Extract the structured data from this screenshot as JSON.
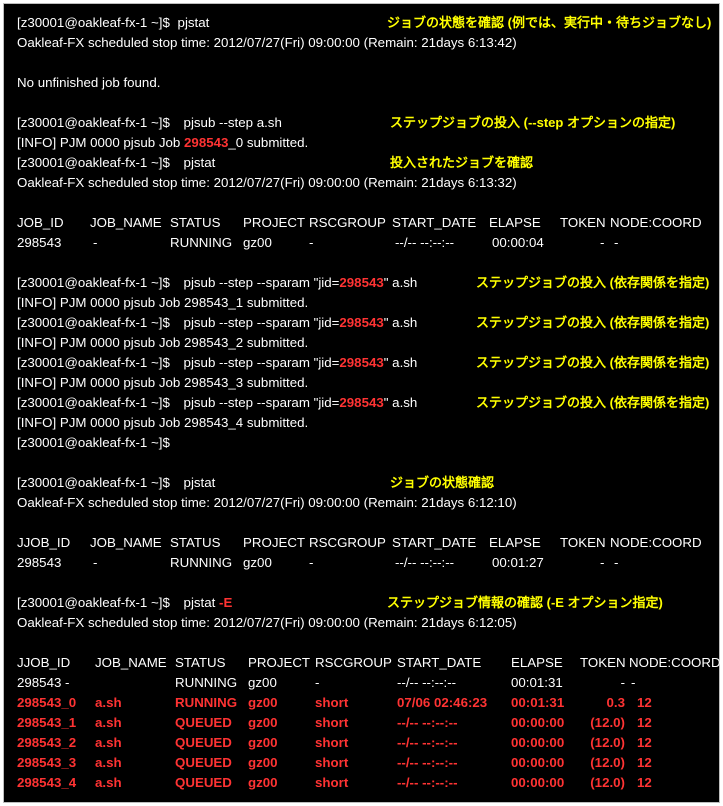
{
  "colors": {
    "background": "#000000",
    "text": "#ffffff",
    "note": "#ffff00",
    "highlight": "#ff3333"
  },
  "prompt": "[z30001@oakleaf-fx-1 ~]$",
  "stop_time_text": {
    "a": "Oakleaf-FX scheduled stop time: 2012/07/27(Fri) 09:00:00 (Remain: 21days 6:13:42)",
    "b": "Oakleaf-FX scheduled stop time: 2012/07/27(Fri) 09:00:00 (Remain: 21days 6:13:32)",
    "c": "Oakleaf-FX scheduled stop time: 2012/07/27(Fri) 09:00:00 (Remain: 21days 6:12:10)",
    "d": "Oakleaf-FX scheduled stop time: 2012/07/27(Fri) 09:00:00 (Remain: 21days 6:12:05)"
  },
  "block1": {
    "cmd": "pjstat",
    "note": "ジョブの状態を確認 (例では、実行中・待ちジョブなし)",
    "result": "No unfinished job found."
  },
  "block2": {
    "cmd": "pjsub --step a.sh",
    "note": "ステップジョブの投入 (--step オプションの指定)",
    "info_pre": "[INFO] PJM 0000 pjsub Job ",
    "job_id": "298543",
    "info_post": "_0 submitted.",
    "cmd2": "pjstat",
    "note2": "投入されたジョブを確認",
    "header": [
      "JOB_ID",
      "JOB_NAME",
      "STATUS",
      "PROJECT",
      "RSCGROUP",
      "START_DATE",
      "ELAPSE",
      "TOKEN",
      "NODE:COORD"
    ],
    "row": [
      "298543",
      "-",
      "RUNNING",
      "gz00",
      "-",
      "--/-- --:--:--",
      "00:00:04",
      "-",
      "-"
    ]
  },
  "block3": {
    "cmd_pre": "pjsub --step --sparam \"jid=",
    "job_id": "298543",
    "cmd_post": "\" a.sh",
    "note": "ステップジョブの投入 (依存関係を指定)",
    "infos": [
      "[INFO] PJM 0000 pjsub Job 298543_1 submitted.",
      "[INFO] PJM 0000 pjsub Job 298543_2 submitted.",
      "[INFO] PJM 0000 pjsub Job 298543_3 submitted.",
      "[INFO] PJM 0000 pjsub Job 298543_4 submitted."
    ]
  },
  "block4": {
    "cmd": "pjstat",
    "note": "ジョブの状態確認",
    "header": [
      "JJOB_ID",
      "JOB_NAME",
      "STATUS",
      "PROJECT",
      "RSCGROUP",
      "START_DATE",
      "ELAPSE",
      "TOKEN",
      "NODE:COORD"
    ],
    "row": [
      "298543",
      "-",
      "RUNNING",
      "gz00",
      "-",
      "--/-- --:--:--",
      "00:01:27",
      "-",
      "-"
    ]
  },
  "block5": {
    "cmd": "pjstat ",
    "cmd_opt": "-E",
    "note": "ステップジョブ情報の確認 (-E オプション指定)",
    "header": [
      "JJOB_ID",
      "JOB_NAME",
      "STATUS",
      "PROJECT",
      "RSCGROUP",
      "START_DATE",
      "ELAPSE",
      "TOKEN",
      "NODE:COORD"
    ],
    "rows": [
      [
        "298543",
        "-",
        "RUNNING",
        "gz00",
        "-",
        "--/-- --:--:--",
        "00:01:31",
        "-",
        "-"
      ],
      [
        "298543_0",
        "a.sh",
        "RUNNING",
        "gz00",
        "short",
        "07/06 02:46:23",
        "00:01:31",
        "0.3",
        "12"
      ],
      [
        "298543_1",
        "a.sh",
        "QUEUED",
        "gz00",
        "short",
        "--/-- --:--:--",
        "00:00:00",
        "(12.0)",
        "12"
      ],
      [
        "298543_2",
        "a.sh",
        "QUEUED",
        "gz00",
        "short",
        "--/-- --:--:--",
        "00:00:00",
        "(12.0)",
        "12"
      ],
      [
        "298543_3",
        "a.sh",
        "QUEUED",
        "gz00",
        "short",
        "--/-- --:--:--",
        "00:00:00",
        "(12.0)",
        "12"
      ],
      [
        "298543_4",
        "a.sh",
        "QUEUED",
        "gz00",
        "short",
        "--/-- --:--:--",
        "00:00:00",
        "(12.0)",
        "12"
      ]
    ]
  }
}
